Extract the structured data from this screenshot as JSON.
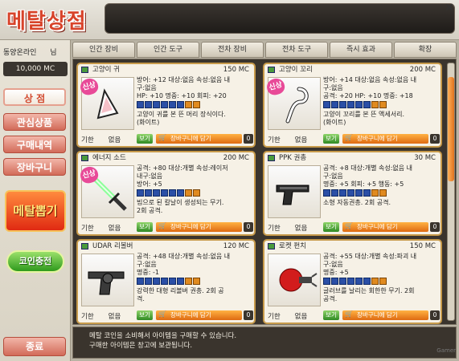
{
  "header": {
    "title": "메탈상점"
  },
  "sidebar": {
    "user_name": "동양온라인",
    "user_suffix": "님",
    "balance": "10,000 MC",
    "nav": [
      {
        "label": "상 점"
      },
      {
        "label": "관심상품"
      },
      {
        "label": "구매내역"
      },
      {
        "label": "장바구니"
      }
    ],
    "gacha_label": "메탈뽑기",
    "charge_label": "코인충전",
    "exit_label": "종료"
  },
  "tabs": [
    "인간 장비",
    "인간 도구",
    "전차 장비",
    "전차 도구",
    "즉시 효과",
    "확장"
  ],
  "common": {
    "period_label": "기한",
    "period_value": "없음",
    "view_label": "보기",
    "cart_label": "장바구니에 담기",
    "cart_count": "0",
    "new_badge": "신상"
  },
  "items": [
    {
      "name": "고양이 귀",
      "price": "150 MC",
      "is_new": true,
      "stats": "방어: +12 대상:없음 속성:없음 내\n구:없음\nHP: +10 명중: +10 회피: +20",
      "desc": "고양이 귀를 본 뜬 머리 장식이다.\n(화이트)"
    },
    {
      "name": "고양이 꼬리",
      "price": "200 MC",
      "is_new": true,
      "stats": "방어: +14 대상:없음 속성:없음 내\n구:없음\n공격: +20 HP: +10 명중: +18",
      "desc": "고양이 꼬리를 본 뜬 액세서리.\n(화이트)"
    },
    {
      "name": "에너지 소드",
      "price": "200 MC",
      "is_new": true,
      "stats": "공격: +80 대상:개별 속성:레이저\n내구:없음\n방어: +5",
      "desc": "빔으로 된 칼날이 생성되는 무기.\n2회 공격."
    },
    {
      "name": "PPK 권총",
      "price": "30 MC",
      "is_new": false,
      "stats": "공격: +8 대상:개별 속성:없음 내\n구:없음\n명중: +5 회피: +5 행동: +5",
      "desc": "소형 자동권총. 2회 공격."
    },
    {
      "name": "UDAR 리볼버",
      "price": "120 MC",
      "is_new": false,
      "stats": "공격: +48 대상:개별 속성:없음 내\n구:없음\n명중: -1",
      "desc": "강력한 대형 리볼버 권총. 2회 공\n격."
    },
    {
      "name": "로켓 펀치",
      "price": "150 MC",
      "is_new": false,
      "stats": "공격: +55 대상:개별 속성:파괴 내\n구:없음\n명중: +5",
      "desc": "글러브를 날리는 회한한 무기. 2회\n공격."
    }
  ],
  "footer": {
    "line1": "메탈 코인을 소비해서 아이템을 구매할 수 있습니다.",
    "line2": "구매한 아이템은 창고에 보관됩니다."
  },
  "watermark": "Gamer"
}
